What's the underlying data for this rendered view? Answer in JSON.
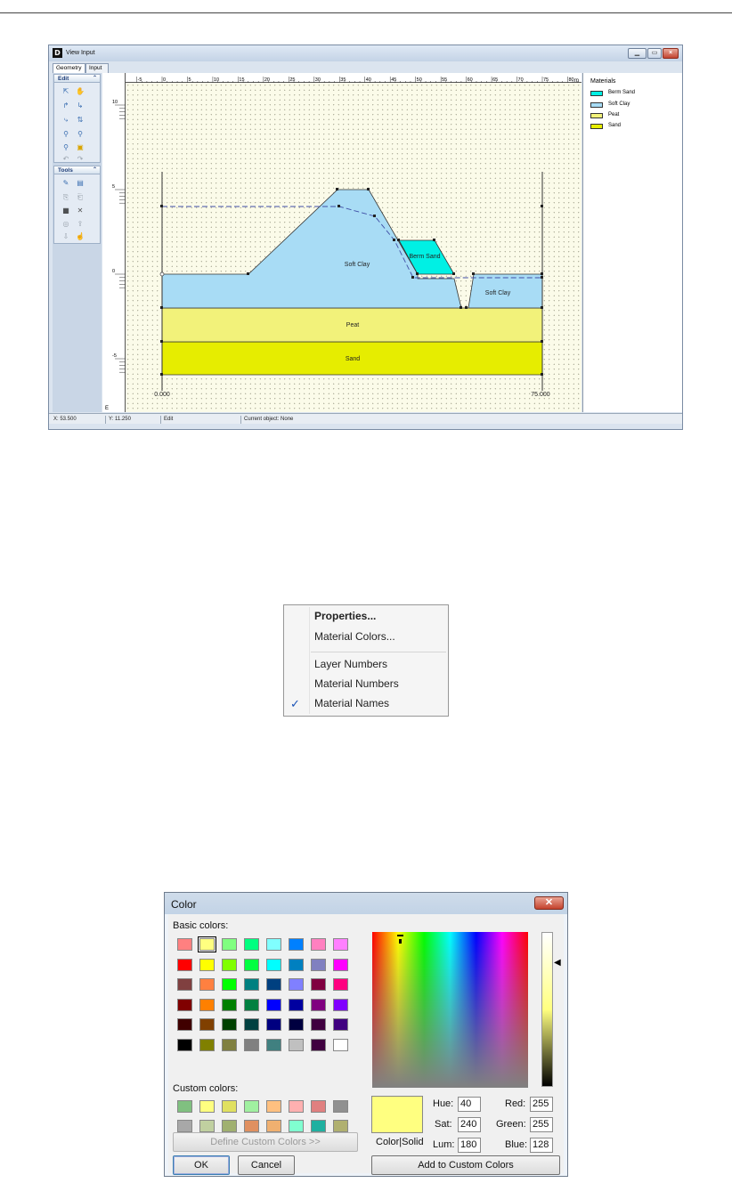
{
  "view_input": {
    "app_icon": "D",
    "title": "View Input",
    "window_buttons": [
      "minimize",
      "maximize",
      "close"
    ],
    "tabs": [
      "Geometry",
      "Input"
    ],
    "edit_group": {
      "title": "Edit"
    },
    "tools_group": {
      "title": "Tools"
    },
    "ruler_top_labels": [
      "-5",
      "0",
      "5",
      "10",
      "15",
      "20",
      "25",
      "30",
      "35",
      "40",
      "45",
      "50",
      "55",
      "60",
      "65",
      "70",
      "75",
      "80"
    ],
    "ruler_left_labels": [
      "10",
      "5",
      "0",
      "-5"
    ],
    "ruler_corner": "m",
    "ruler_left_bottom": "E",
    "canvas": {
      "origin_label": "0.000",
      "end_label": "75.000",
      "layer_labels": [
        "Soft Clay",
        "Berm Sand",
        "Soft Clay",
        "Peat",
        "Sand"
      ]
    },
    "legend": {
      "title": "Materials",
      "items": [
        {
          "name": "Berm Sand",
          "color": "#00f0e4"
        },
        {
          "name": "Soft Clay",
          "color": "#a8dcf5"
        },
        {
          "name": "Peat",
          "color": "#f2f27a"
        },
        {
          "name": "Sand",
          "color": "#e6ed00"
        }
      ]
    },
    "status": {
      "x": "X: 53.500",
      "y": "Y: 11.250",
      "mode": "Edit",
      "object": "Current object: None"
    }
  },
  "context_menu": {
    "items": [
      {
        "label": "Properties...",
        "bold": true,
        "checked": false
      },
      {
        "label": "Material Colors...",
        "bold": false,
        "checked": false
      },
      {
        "label": "Layer Numbers",
        "bold": false,
        "checked": false
      },
      {
        "label": "Material Numbers",
        "bold": false,
        "checked": false
      },
      {
        "label": "Material Names",
        "bold": false,
        "checked": true
      }
    ]
  },
  "color_dialog": {
    "title": "Color",
    "basic_colors_label": "Basic colors:",
    "custom_colors_label": "Custom colors:",
    "basic_colors": [
      "#ff8080",
      "#ffff80",
      "#80ff80",
      "#00ff80",
      "#80ffff",
      "#0080ff",
      "#ff80c0",
      "#ff80ff",
      "#ff0000",
      "#ffff00",
      "#80ff00",
      "#00ff40",
      "#00ffff",
      "#0080c0",
      "#8080c0",
      "#ff00ff",
      "#804040",
      "#ff8040",
      "#00ff00",
      "#008080",
      "#004080",
      "#8080ff",
      "#800040",
      "#ff0080",
      "#800000",
      "#ff8000",
      "#008000",
      "#008040",
      "#0000ff",
      "#0000a0",
      "#800080",
      "#8000ff",
      "#400000",
      "#804000",
      "#004000",
      "#004040",
      "#000080",
      "#000040",
      "#400040",
      "#400080",
      "#000000",
      "#808000",
      "#808040",
      "#808080",
      "#408080",
      "#c0c0c0",
      "#400040",
      "#ffffff"
    ],
    "selected_basic": 1,
    "custom_colors": [
      "#80c080",
      "#ffff80",
      "#e0e060",
      "#a0f0a0",
      "#ffc080",
      "#ffb0b0",
      "#e08080",
      "#909090",
      "#a8a8a8",
      "#c0d0a0",
      "#a0b070",
      "#e09060",
      "#f0b070",
      "#80ffd0",
      "#20b0a0",
      "#b0b070"
    ],
    "define_custom_button": "Define Custom Colors >>",
    "ok_button": "OK",
    "cancel_button": "Cancel",
    "color_solid_label": "Color|Solid",
    "hue_label": "Hue:",
    "hue": "40",
    "sat_label": "Sat:",
    "sat": "240",
    "lum_label": "Lum:",
    "lum": "180",
    "red_label": "Red:",
    "red": "255",
    "green_label": "Green:",
    "green": "255",
    "blue_label": "Blue:",
    "blue": "128",
    "add_custom_button": "Add to Custom Colors"
  }
}
